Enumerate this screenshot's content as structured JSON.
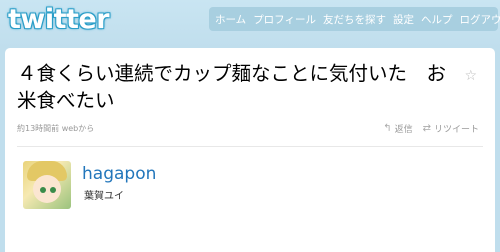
{
  "brand": {
    "logo_text": "twitter"
  },
  "nav": {
    "items": [
      "ホーム",
      "プロフィール",
      "友だちを探す",
      "設定",
      "ヘルプ",
      "ログアウト"
    ]
  },
  "tweet": {
    "text": "４食くらい連続でカップ麺なことに気付いた　お米食べたい",
    "meta": "約13時間前 webから",
    "reply_label": "返信",
    "retweet_label": "リツイート",
    "reply_icon": "reply-arrow-icon",
    "retweet_icon": "retweet-icon",
    "favorite_icon": "star-icon"
  },
  "user": {
    "screen_name": "hagapon",
    "full_name": "葉賀ユイ"
  },
  "colors": {
    "background": "#c0deed",
    "link": "#2276bb",
    "nav_bg": "#a8cfe0"
  }
}
